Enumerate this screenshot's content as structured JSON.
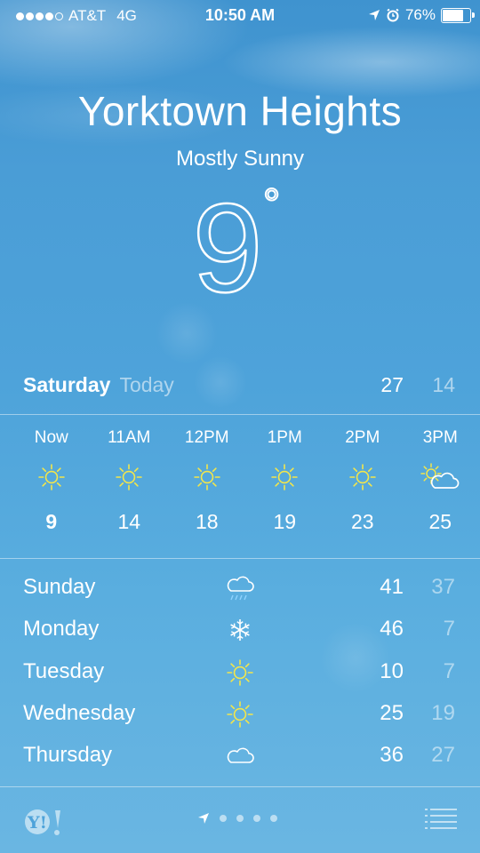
{
  "status_bar": {
    "carrier": "AT&T",
    "network": "4G",
    "time": "10:50 AM",
    "battery": "76%",
    "battery_level": 0.76,
    "signal_bars_filled": 4,
    "signal_bars_total": 5,
    "icons": [
      "location-arrow-icon",
      "alarm-clock-icon",
      "battery-icon"
    ]
  },
  "location": {
    "city": "Yorktown Heights",
    "condition": "Mostly Sunny",
    "temperature": "9",
    "degree_symbol": "°"
  },
  "today": {
    "day": "Saturday",
    "label": "Today",
    "high": "27",
    "low": "14"
  },
  "hourly": [
    {
      "time": "Now",
      "icon": "sun-icon",
      "temp": "9"
    },
    {
      "time": "11AM",
      "icon": "sun-icon",
      "temp": "14"
    },
    {
      "time": "12PM",
      "icon": "sun-icon",
      "temp": "18"
    },
    {
      "time": "1PM",
      "icon": "sun-icon",
      "temp": "19"
    },
    {
      "time": "2PM",
      "icon": "sun-icon",
      "temp": "23"
    },
    {
      "time": "3PM",
      "icon": "partly-cloudy-icon",
      "temp": "25"
    }
  ],
  "daily": [
    {
      "day": "Sunday",
      "icon": "rain-cloud-icon",
      "high": "41",
      "low": "37"
    },
    {
      "day": "Monday",
      "icon": "snowflake-icon",
      "high": "46",
      "low": "7"
    },
    {
      "day": "Tuesday",
      "icon": "sun-icon",
      "high": "10",
      "low": "7"
    },
    {
      "day": "Wednesday",
      "icon": "sun-icon",
      "high": "25",
      "low": "19"
    },
    {
      "day": "Thursday",
      "icon": "cloud-icon",
      "high": "36",
      "low": "27"
    }
  ],
  "footer": {
    "logo": "Y!",
    "page_indicator_count": 4,
    "icons": [
      "yahoo-logo-icon",
      "location-arrow-icon",
      "list-icon"
    ]
  },
  "colors": {
    "sky_top": "#3f93cf",
    "sky_bottom": "#6ab6e2",
    "sun": "#f3e64a",
    "rain": "#8fd3ff",
    "text": "#ffffff"
  }
}
